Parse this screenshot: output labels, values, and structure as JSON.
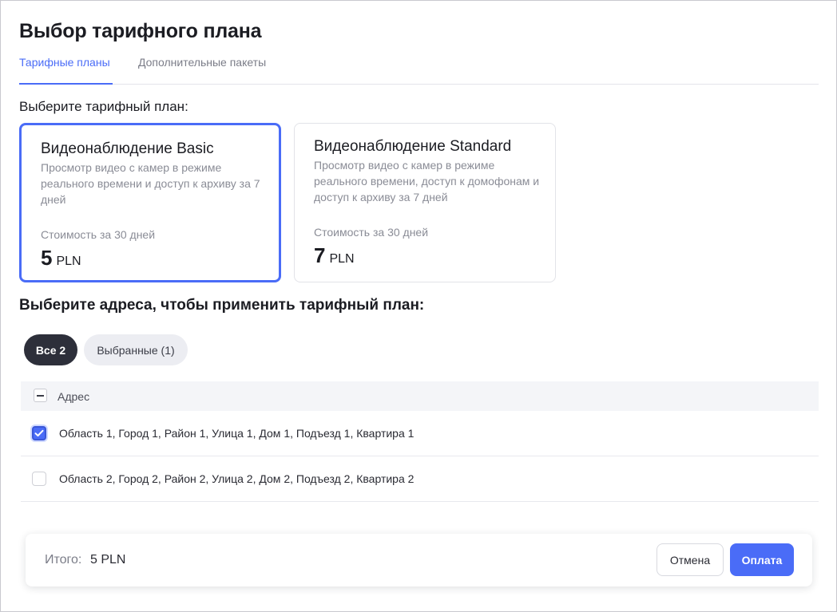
{
  "page": {
    "title": "Выбор тарифного плана"
  },
  "tabs": [
    {
      "label": "Тарифные планы",
      "active": true
    },
    {
      "label": "Дополнительные пакеты",
      "active": false
    }
  ],
  "plans_section": {
    "label": "Выберите тарифный план:"
  },
  "plans": [
    {
      "title": "Видеонаблюдение Basic",
      "description": "Просмотр видео с камер в режиме реального времени и доступ к архиву за 7 дней",
      "cost_label": "Стоимость за 30 дней",
      "price": "5",
      "currency": "PLN",
      "selected": true
    },
    {
      "title": "Видеонаблюдение Standard",
      "description": "Просмотр видео с камер в режиме реального времени, доступ к домофонам и доступ к архиву за 7 дней",
      "cost_label": "Стоимость за 30 дней",
      "price": "7",
      "currency": "PLN",
      "selected": false
    }
  ],
  "addresses_section": {
    "heading": "Выберите адреса, чтобы применить тарифный план:",
    "filters": [
      {
        "label": "Все 2",
        "active": true
      },
      {
        "label": "Выбранные (1)",
        "active": false
      }
    ],
    "table": {
      "header": "Адрес",
      "rows": [
        {
          "address": "Область 1, Город 1, Район 1, Улица 1, Дом 1, Подъезд 1, Квартира 1",
          "checked": true
        },
        {
          "address": "Область 2, Город 2, Район 2, Улица 2, Дом 2, Подъезд 2, Квартира 2",
          "checked": false
        }
      ]
    }
  },
  "footer": {
    "total_label": "Итого:",
    "total_value": "5 PLN",
    "cancel_label": "Отмена",
    "pay_label": "Оплата"
  },
  "colors": {
    "accent": "#4a6cf7",
    "dark_pill": "#2d2f3a",
    "muted_text": "#8a8c96"
  }
}
